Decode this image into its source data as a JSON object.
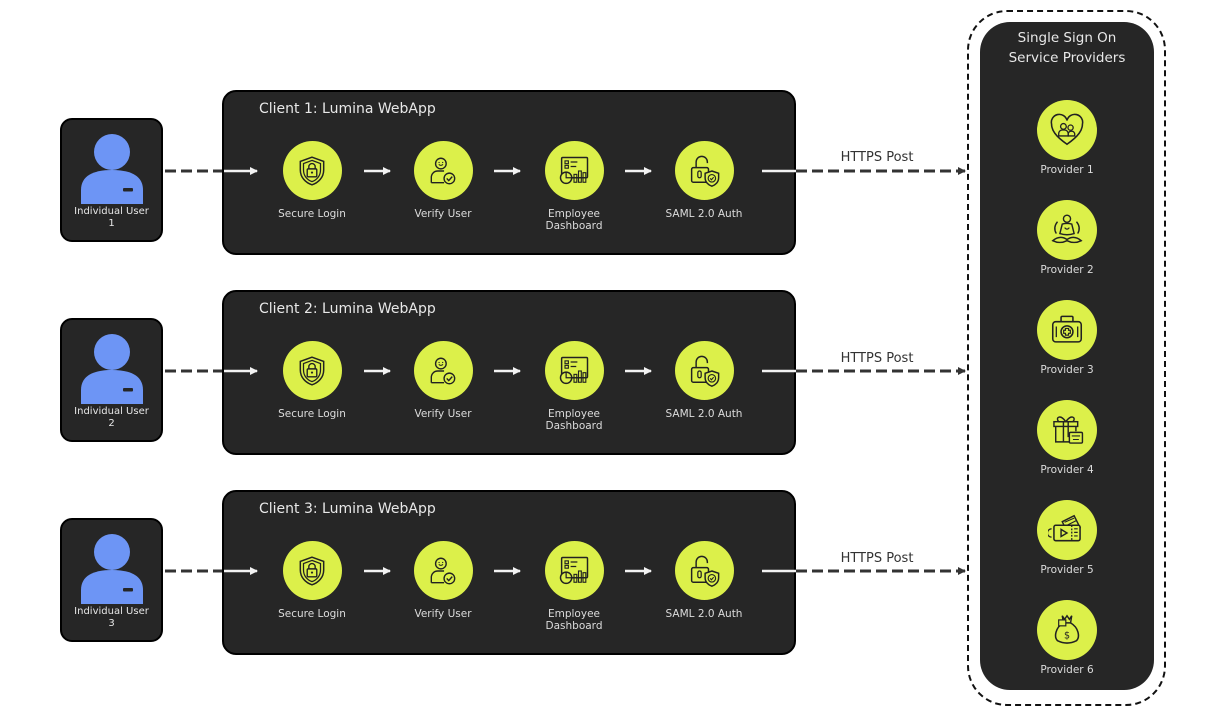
{
  "colors": {
    "panel": "#262626",
    "accent": "#dcf04a",
    "avatar": "#6d95f5",
    "connector": "#333333",
    "inner_arrow": "#f2f2f2"
  },
  "users": [
    {
      "label": "Individual User",
      "number": "1",
      "icon": "user-avatar-icon"
    },
    {
      "label": "Individual User",
      "number": "2",
      "icon": "user-avatar-icon"
    },
    {
      "label": "Individual User",
      "number": "3",
      "icon": "user-avatar-icon"
    }
  ],
  "clients": [
    {
      "title": "Client 1: Lumina WebApp",
      "steps": [
        {
          "label": "Secure Login",
          "icon": "shield-lock-icon"
        },
        {
          "label": "Verify User",
          "icon": "user-check-icon"
        },
        {
          "label": "Employee Dashboard",
          "icon": "dashboard-chart-icon"
        },
        {
          "label": "SAML 2.0 Auth",
          "icon": "unlock-shield-icon"
        }
      ],
      "connector_label": "HTTPS Post"
    },
    {
      "title": "Client 2: Lumina WebApp",
      "steps": [
        {
          "label": "Secure Login",
          "icon": "shield-lock-icon"
        },
        {
          "label": "Verify User",
          "icon": "user-check-icon"
        },
        {
          "label": "Employee Dashboard",
          "icon": "dashboard-chart-icon"
        },
        {
          "label": "SAML 2.0 Auth",
          "icon": "unlock-shield-icon"
        }
      ],
      "connector_label": "HTTPS Post"
    },
    {
      "title": "Client 3: Lumina WebApp",
      "steps": [
        {
          "label": "Secure Login",
          "icon": "shield-lock-icon"
        },
        {
          "label": "Verify User",
          "icon": "user-check-icon"
        },
        {
          "label": "Employee Dashboard",
          "icon": "dashboard-chart-icon"
        },
        {
          "label": "SAML 2.0 Auth",
          "icon": "unlock-shield-icon"
        }
      ],
      "connector_label": "HTTPS Post"
    }
  ],
  "sso": {
    "title_line1": "Single Sign On",
    "title_line2": "Service Providers",
    "providers": [
      {
        "label": "Provider 1",
        "icon": "heart-people-icon"
      },
      {
        "label": "Provider 2",
        "icon": "meditation-icon"
      },
      {
        "label": "Provider 3",
        "icon": "first-aid-kit-icon"
      },
      {
        "label": "Provider 4",
        "icon": "gift-thank-you-icon"
      },
      {
        "label": "Provider 5",
        "icon": "tickets-icon"
      },
      {
        "label": "Provider 6",
        "icon": "money-bag-icon"
      }
    ]
  }
}
